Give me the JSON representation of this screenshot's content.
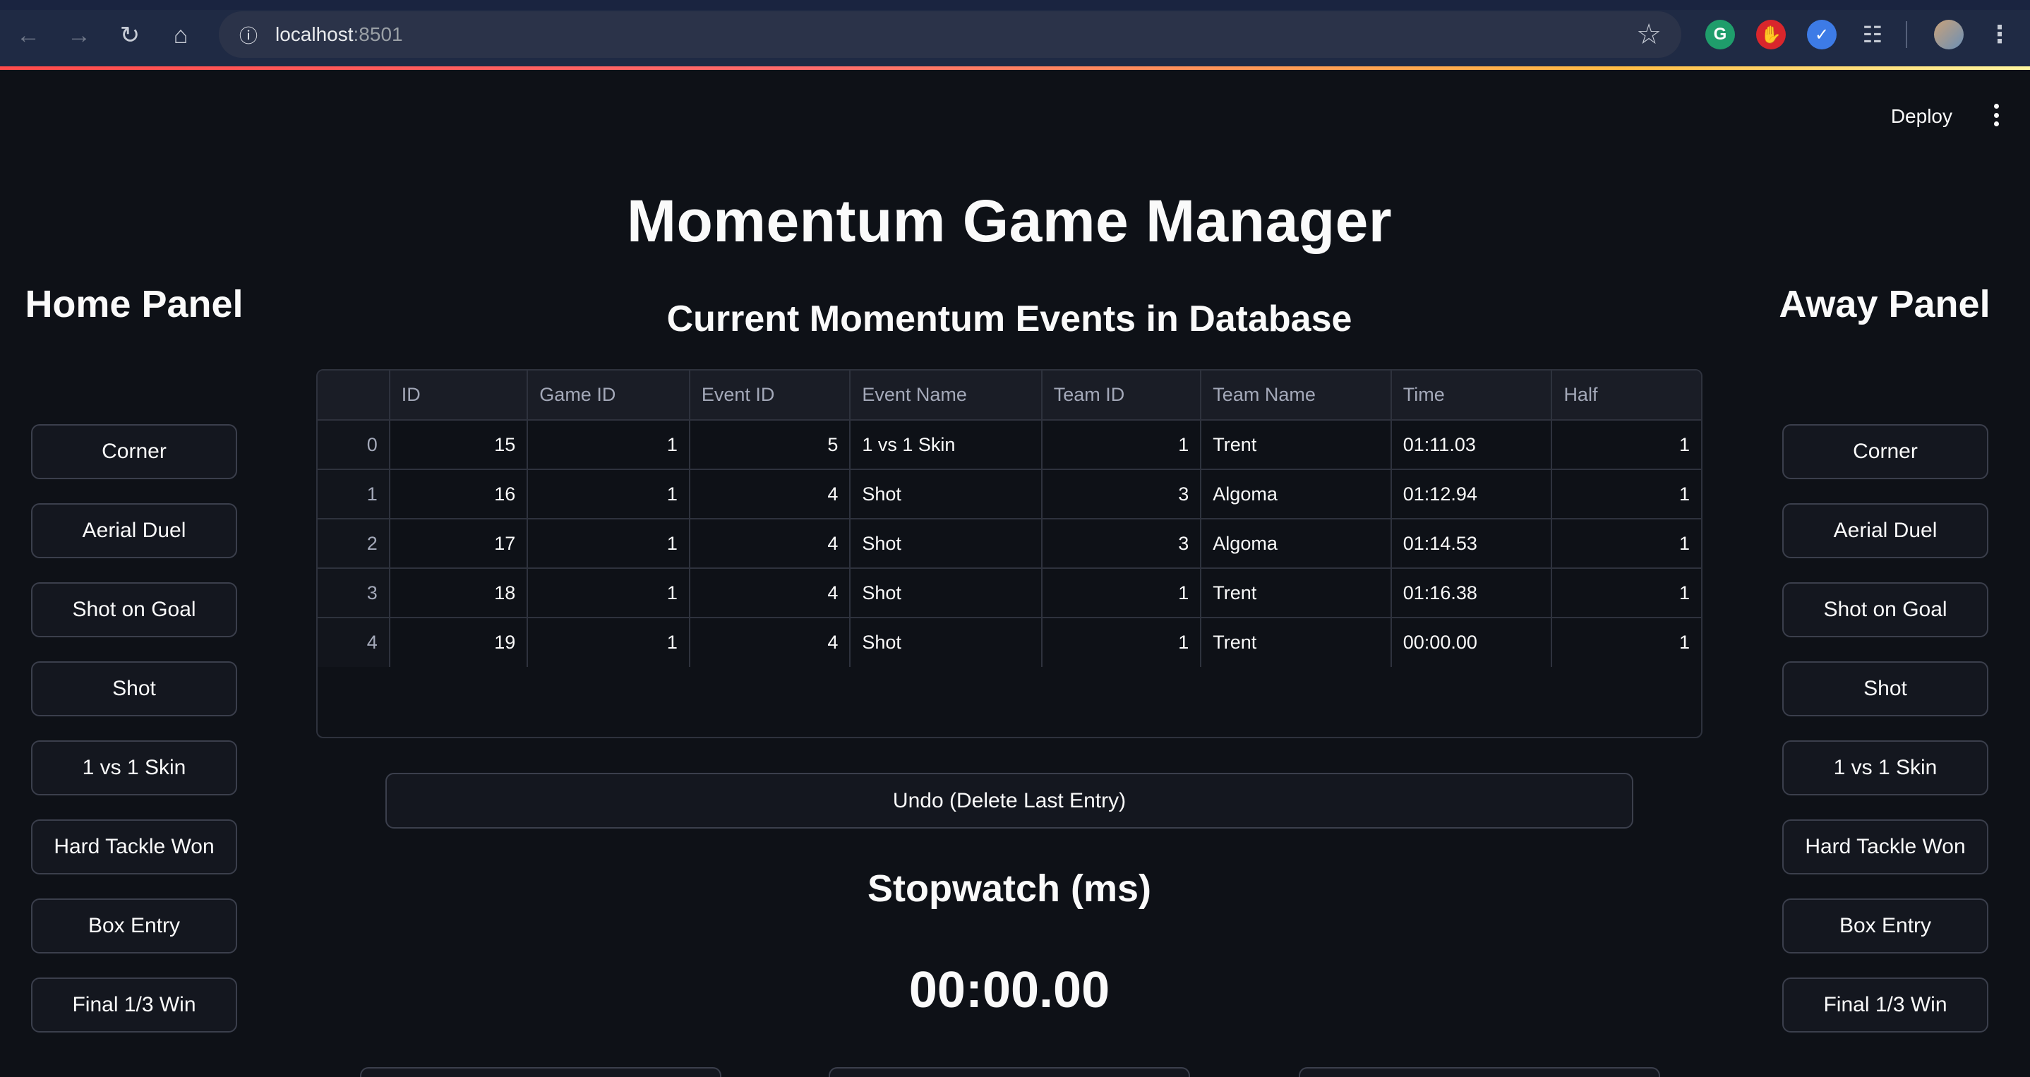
{
  "browser": {
    "url_host": "localhost",
    "url_port": ":8501",
    "icons": [
      "back-icon",
      "forward-icon",
      "reload-icon",
      "home-icon",
      "site-info-icon",
      "bookmark-star-icon",
      "grammarly-icon",
      "adblock-icon",
      "extension-icon",
      "puzzle-icon",
      "profile-avatar",
      "menu-icon"
    ]
  },
  "header": {
    "deploy_label": "Deploy"
  },
  "main": {
    "title": "Momentum Game Manager",
    "events_title": "Current Momentum Events in Database",
    "undo_label": "Undo (Delete Last Entry)",
    "stopwatch_title": "Stopwatch (ms)",
    "stopwatch_value": "00:00.00"
  },
  "home_panel": {
    "title": "Home Panel",
    "buttons": [
      "Corner",
      "Aerial Duel",
      "Shot on Goal",
      "Shot",
      "1 vs 1 Skin",
      "Hard Tackle Won",
      "Box Entry",
      "Final 1/3 Win"
    ]
  },
  "away_panel": {
    "title": "Away Panel",
    "buttons": [
      "Corner",
      "Aerial Duel",
      "Shot on Goal",
      "Shot",
      "1 vs 1 Skin",
      "Hard Tackle Won",
      "Box Entry",
      "Final 1/3 Win"
    ]
  },
  "table": {
    "columns": [
      "",
      "ID",
      "Game ID",
      "Event ID",
      "Event Name",
      "Team ID",
      "Team Name",
      "Time",
      "Half"
    ],
    "rows": [
      [
        "0",
        "15",
        "1",
        "5",
        "1 vs 1 Skin",
        "1",
        "Trent",
        "01:11.03",
        "1"
      ],
      [
        "1",
        "16",
        "1",
        "4",
        "Shot",
        "3",
        "Algoma",
        "01:12.94",
        "1"
      ],
      [
        "2",
        "17",
        "1",
        "4",
        "Shot",
        "3",
        "Algoma",
        "01:14.53",
        "1"
      ],
      [
        "3",
        "18",
        "1",
        "4",
        "Shot",
        "1",
        "Trent",
        "01:16.38",
        "1"
      ],
      [
        "4",
        "19",
        "1",
        "4",
        "Shot",
        "1",
        "Trent",
        "00:00.00",
        "1"
      ]
    ]
  },
  "colors": {
    "background": "#0e1117",
    "button_bg": "#14171f",
    "border": "#3b3f4c",
    "text": "#fafafa"
  }
}
